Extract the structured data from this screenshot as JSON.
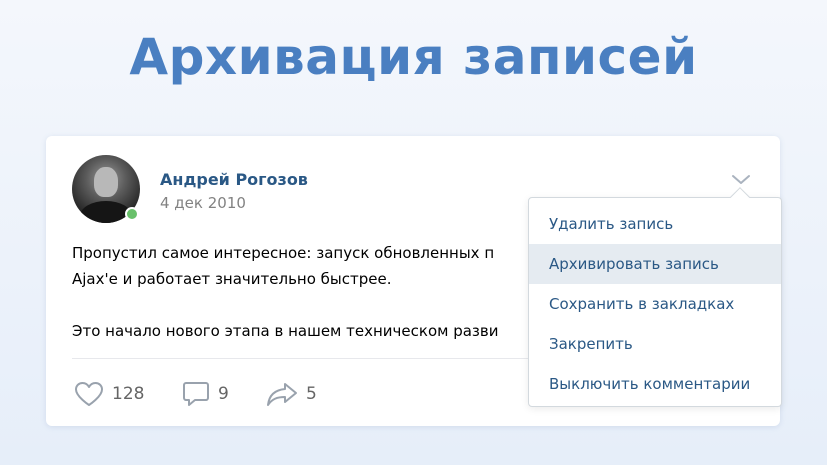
{
  "headline": "Архивация записей",
  "post": {
    "author": "Андрей Рогозов",
    "date": "4 дек 2010",
    "paragraph_1_line_1": "Пропустил самое интересное: запуск обновленных п",
    "paragraph_1_line_2": "Ajax'е и работает значительно быстрее.",
    "paragraph_2": "Это начало нового этапа в нашем техническом разви",
    "likes": "128",
    "comments": "9",
    "shares": "5"
  },
  "menu": {
    "items": [
      {
        "label": "Удалить запись"
      },
      {
        "label": "Архивировать запись",
        "active": true
      },
      {
        "label": "Сохранить в закладках"
      },
      {
        "label": "Закрепить"
      },
      {
        "label": "Выключить комментарии"
      }
    ]
  },
  "colors": {
    "headline": "#4a7fc1",
    "link": "#2a5885",
    "online": "#68c06a",
    "menu_hover": "#e5ebf1"
  },
  "icons": {
    "menu_toggle": "chevron-down-icon",
    "likes": "heart-icon",
    "comments": "comment-icon",
    "shares": "share-arrow-icon",
    "online": "online-status-icon"
  }
}
